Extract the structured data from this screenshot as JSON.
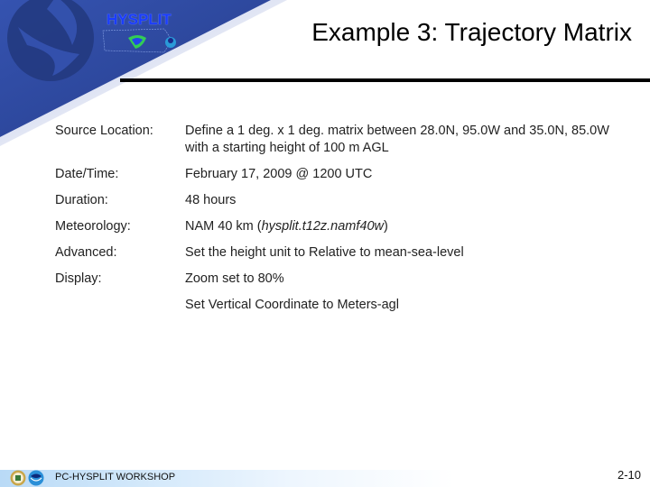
{
  "header": {
    "logo_text": "HYSPLIT",
    "title": "Example 3: Trajectory Matrix"
  },
  "rows": [
    {
      "label": "Source Location:",
      "value": "Define a 1 deg. x 1 deg. matrix between 28.0N, 95.0W and 35.0N, 85.0W with a starting height of 100 m AGL"
    },
    {
      "label": "Date/Time:",
      "value": "February 17, 2009 @ 1200 UTC"
    },
    {
      "label": "Duration:",
      "value": "48 hours"
    },
    {
      "label": "Meteorology:",
      "value_prefix": "NAM 40 km (",
      "value_italic": "hysplit.t12z.namf40w",
      "value_suffix": ")"
    },
    {
      "label": "Advanced:",
      "value": "Set the height unit to Relative to mean-sea-level"
    },
    {
      "label": "Display:",
      "value": "Zoom set to 80%"
    },
    {
      "label": "",
      "value": "Set Vertical Coordinate to Meters-agl"
    }
  ],
  "footer": {
    "text": "PC-HYSPLIT WORKSHOP",
    "page_number": "2-10"
  },
  "colors": {
    "banner": "#2e4a9e",
    "logo_text": "#1a3cff"
  }
}
